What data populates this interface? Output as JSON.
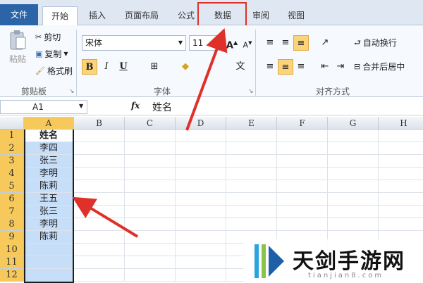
{
  "tabs": [
    {
      "label": "文件"
    },
    {
      "label": "开始"
    },
    {
      "label": "插入"
    },
    {
      "label": "页面布局"
    },
    {
      "label": "公式"
    },
    {
      "label": "数据"
    },
    {
      "label": "审阅"
    },
    {
      "label": "视图"
    }
  ],
  "ribbon": {
    "clipboard": {
      "paste": "粘贴",
      "cut": "剪切",
      "copy": "复制",
      "format_painter": "格式刷",
      "group": "剪贴板"
    },
    "font": {
      "name": "宋体",
      "size": "11",
      "bold": "B",
      "italic": "I",
      "underline": "U",
      "group": "字体"
    },
    "alignment": {
      "wrap": "自动换行",
      "merge": "合并后居中",
      "group": "对齐方式"
    }
  },
  "formula_bar": {
    "cell_ref": "A1",
    "fx": "fx",
    "content": "姓名"
  },
  "columns": [
    "A",
    "B",
    "C",
    "D",
    "E",
    "F",
    "G",
    "H"
  ],
  "rows": [
    "1",
    "2",
    "3",
    "4",
    "5",
    "6",
    "7",
    "8",
    "9",
    "10",
    "11",
    "12"
  ],
  "column_a": [
    "姓名",
    "李四",
    "张三",
    "李明",
    "陈莉",
    "王五",
    "张三",
    "李明",
    "陈莉",
    "",
    "",
    ""
  ],
  "watermark": {
    "title": "天剑手游网",
    "subtitle": "tianjian8.com"
  },
  "colors": {
    "accent": "#2c64a8",
    "highlight": "#e0302a",
    "selection": "#c6def8"
  }
}
